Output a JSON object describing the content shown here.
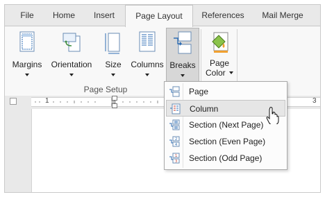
{
  "tabs": [
    "File",
    "Home",
    "Insert",
    "Page Layout",
    "References",
    "Mail Merge"
  ],
  "ribbon": {
    "margins": "Margins",
    "orientation": "Orientation",
    "size": "Size",
    "columns": "Columns",
    "breaks": "Breaks",
    "page_color_line1": "Page",
    "page_color_line2": "Color",
    "group_label": "Page Setup"
  },
  "ruler": {
    "mark_left": "1",
    "mark_right": "3"
  },
  "breaks_menu": {
    "items": [
      "Page",
      "Column",
      "Section (Next Page)",
      "Section (Even Page)",
      "Section (Odd Page)"
    ],
    "hovered": "Column"
  },
  "colors": {
    "accent_blue": "#2e6db4",
    "accent_red": "#c0392b",
    "tab_active_bg": "#f8f8f8"
  }
}
